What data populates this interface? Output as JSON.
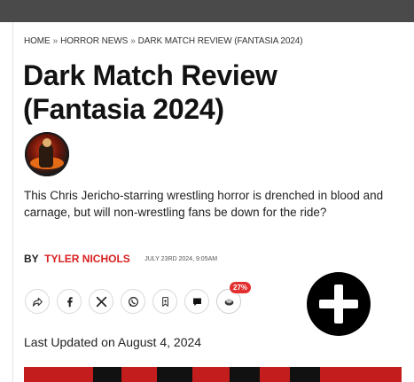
{
  "breadcrumb": {
    "home": "HOME",
    "section": "HORROR NEWS",
    "current": "DARK MATCH REVIEW (FANTASIA 2024)",
    "separator": "»"
  },
  "article": {
    "title": "Dark Match Review (Fantasia 2024)",
    "summary": "This Chris Jericho-starring wrestling horror is drenched in blood and carnage, but will non-wrestling fans be down for the ride?",
    "by_label": "BY",
    "author": "TYLER NICHOLS",
    "date": "JULY 23RD 2024, 9:05AM",
    "last_updated": "Last Updated on August 4, 2024"
  },
  "share": {
    "icons": [
      "share-icon",
      "facebook-icon",
      "x-icon",
      "whatsapp-icon",
      "bookmark-icon",
      "comment-icon",
      "reaction-icon"
    ],
    "badge": "27%"
  },
  "colors": {
    "accent": "#d81f1f",
    "topbar": "#4a4a4a",
    "fab": "#000000"
  }
}
